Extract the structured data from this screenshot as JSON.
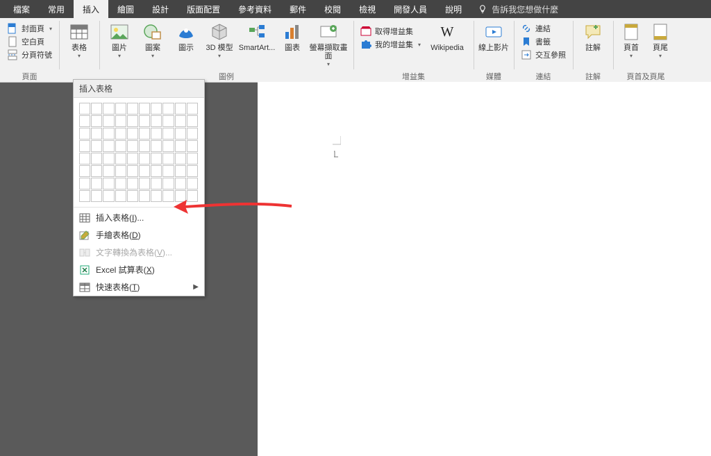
{
  "tabs": {
    "file": "檔案",
    "home": "常用",
    "insert": "插入",
    "draw": "繪圖",
    "design": "設計",
    "layout": "版面配置",
    "references": "參考資料",
    "mailings": "郵件",
    "review": "校閱",
    "view": "檢視",
    "developer": "開發人員",
    "help": "說明"
  },
  "tellme": "告訴我您想做什麼",
  "groups": {
    "pages": {
      "label": "頁面",
      "cover": "封面頁",
      "blank": "空白頁",
      "break": "分頁符號"
    },
    "table": {
      "label": "",
      "btn": "表格"
    },
    "illus": {
      "label": "圖例",
      "pic": "圖片",
      "shapes": "圖案",
      "icons": "圖示",
      "model": "3D 模型",
      "smart": "SmartArt...",
      "chart": "圖表",
      "screenshot": "螢幕擷取畫面"
    },
    "addins": {
      "label": "增益集",
      "get": "取得增益集",
      "my": "我的增益集",
      "wiki": "Wikipedia"
    },
    "media": {
      "label": "媒體",
      "video": "線上影片"
    },
    "links": {
      "label": "連結",
      "link": "連結",
      "bookmark": "書籤",
      "xref": "交互參照"
    },
    "comment": {
      "label": "註解",
      "btn": "註解"
    },
    "hf": {
      "label": "頁首及頁尾",
      "header": "頁首",
      "footer": "頁尾"
    }
  },
  "dropdown": {
    "title": "插入表格",
    "insert": "插入表格(I)...",
    "draw": "手繪表格(D)",
    "convert": "文字轉換為表格(V)...",
    "excel": "Excel 試算表(X)",
    "quick": "快速表格(T)"
  },
  "grid": {
    "rows": 8,
    "cols": 10
  }
}
